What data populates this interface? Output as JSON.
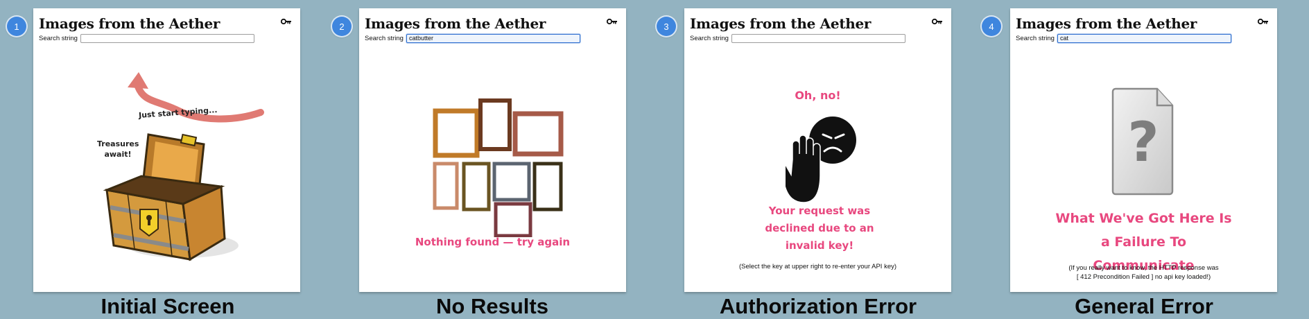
{
  "app_title": "Images from the Aether",
  "search_label": "Search string",
  "panels": [
    {
      "badge": "1",
      "search_value": "",
      "caption": "Initial Screen",
      "hint_text": "Just start typing...",
      "treasure_text": "Treasures await!"
    },
    {
      "badge": "2",
      "search_value": "catbutter",
      "caption": "No Results",
      "message": "Nothing found — try again"
    },
    {
      "badge": "3",
      "search_value": "",
      "caption": "Authorization Error",
      "oh_no": "Oh, no!",
      "message": "Your request was declined due to an invalid key!",
      "note": "(Select the key at upper right to re-enter your API key)"
    },
    {
      "badge": "4",
      "search_value": "cat",
      "caption": "General Error",
      "message": "What We've Got Here Is a Failure To Communicate",
      "note_line1": "(If you really want to know, the HTTP response was",
      "note_line2": "[ 412 Precondition Failed ] no api key loaded!)"
    }
  ],
  "icons": {
    "key": "key-icon",
    "arrow": "curved-arrow-icon",
    "chest": "treasure-chest-icon",
    "frames": "empty-frames-icon",
    "hand": "stop-hand-icon",
    "face": "frowning-face-icon",
    "file": "missing-file-icon"
  },
  "colors": {
    "background": "#93b3c1",
    "badge": "#3f86de",
    "accent_pink": "#e8487f",
    "arrow": "#e07a73",
    "focus": "#2f6fd0"
  }
}
